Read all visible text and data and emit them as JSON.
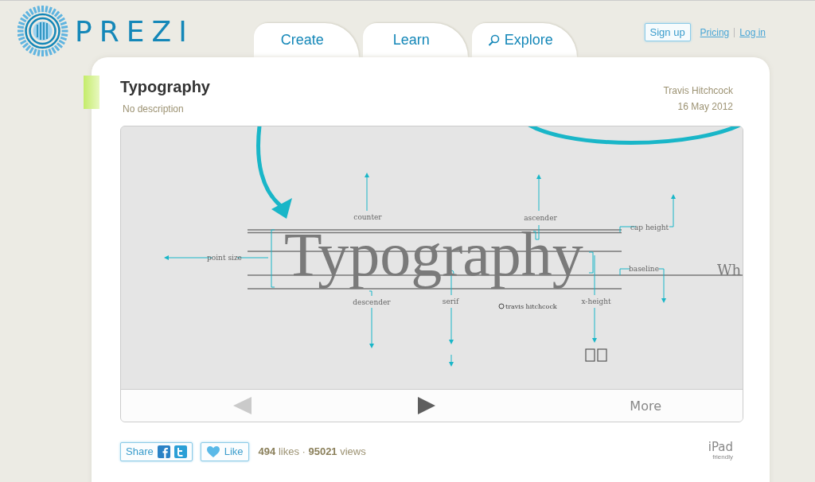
{
  "logo": {
    "wordmark": "PREZI"
  },
  "tabs": [
    {
      "label": "Create",
      "kind": "plain",
      "selected": false
    },
    {
      "label": "Learn",
      "kind": "plain",
      "selected": false
    },
    {
      "label": "Explore",
      "kind": "search",
      "selected": false
    }
  ],
  "account": {
    "signup": "Sign up",
    "links": [
      "Pricing",
      "Log in"
    ]
  },
  "prezi": {
    "title": "Typography",
    "description": "No description",
    "author": "Travis Hitchcock",
    "date": "16 May 2012"
  },
  "slide": {
    "word": "Typography",
    "labels": [
      "counter",
      "ascender",
      "cap height",
      "point size",
      "baseline",
      "descender",
      "serif",
      "x-height"
    ],
    "credit": "travis hitchcock",
    "overflow_text": "Wh"
  },
  "player": {
    "prev": {
      "disabled": true
    },
    "next": {
      "disabled": false
    },
    "more": "More"
  },
  "social": {
    "share": "Share",
    "like": "Like",
    "stats": "**494** likes · **95021** views",
    "ipad": "iPad",
    "ipad_note": "friendly"
  }
}
